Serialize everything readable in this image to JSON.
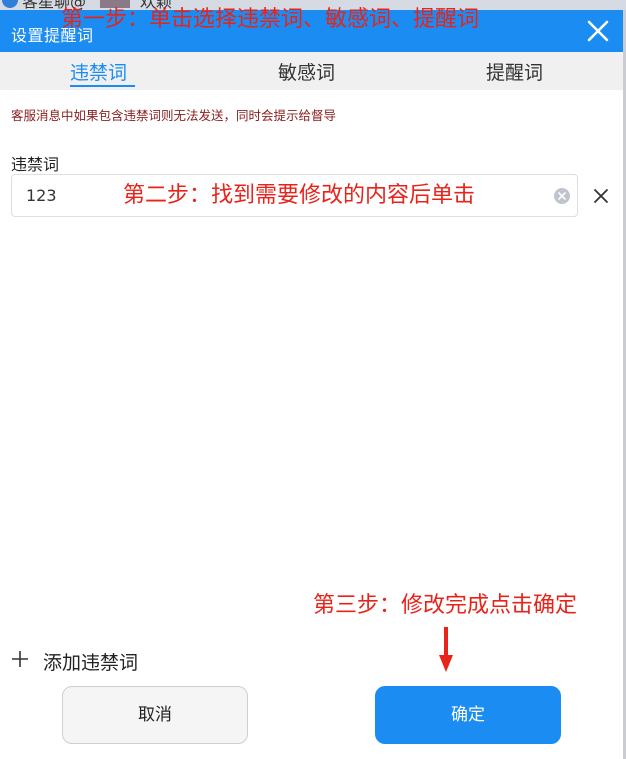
{
  "background": {
    "text_left": "客星聊@",
    "text_right": "欢颖"
  },
  "dialog": {
    "title": "设置提醒词",
    "close_icon": "close-icon"
  },
  "tabs": [
    {
      "label": "违禁词",
      "active": true
    },
    {
      "label": "敏感词",
      "active": false
    },
    {
      "label": "提醒词",
      "active": false
    }
  ],
  "notice": "客服消息中如果包含违禁词则无法发送，同时会提示给督导",
  "field": {
    "label": "违禁词",
    "value": "123"
  },
  "add_label": "添加违禁词",
  "buttons": {
    "cancel": "取消",
    "confirm": "确定"
  },
  "annotations": {
    "step1": "第一步：单击选择违禁词、敏感词、提醒词",
    "step2": "第二步：找到需要修改的内容后单击",
    "step3": "第三步：修改完成点击确定"
  },
  "colors": {
    "accent": "#1a8cf2",
    "annotation": "#e8231a",
    "notice": "#8b2020"
  }
}
